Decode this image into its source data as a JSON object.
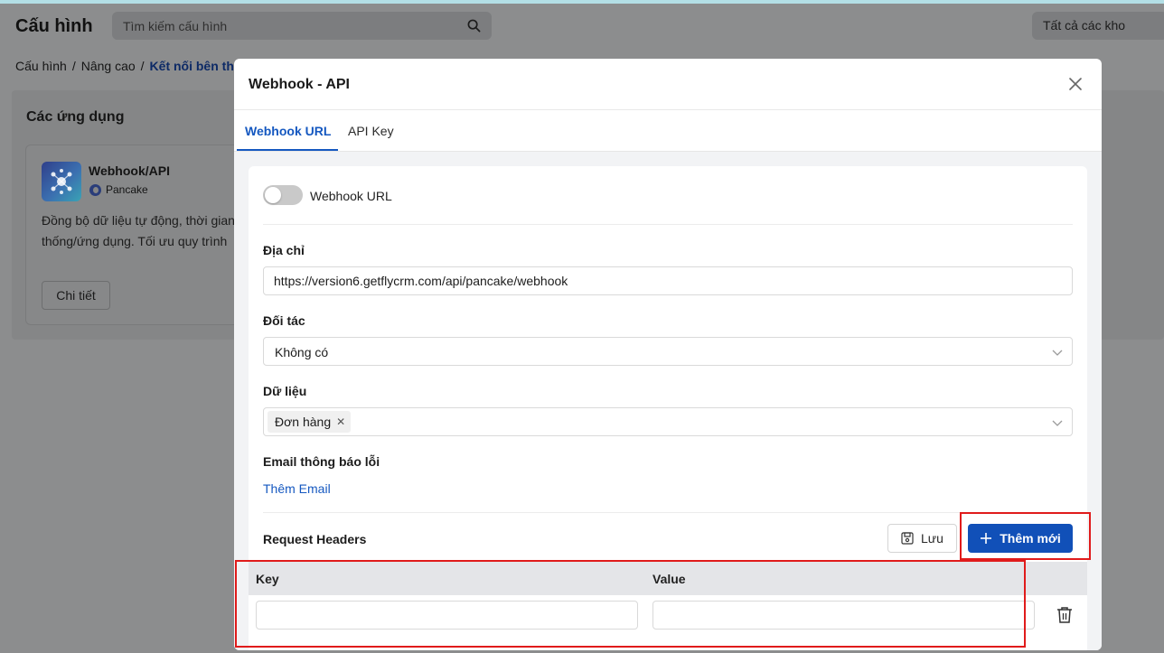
{
  "page": {
    "title": "Cấu hình",
    "search_placeholder": "Tìm kiếm cấu hình",
    "store_select": "Tất cả các kho",
    "breadcrumb": [
      "Cấu hình",
      "Nâng cao",
      "Kết nối bên th"
    ]
  },
  "apps": {
    "title": "Các ứng dụng",
    "card": {
      "name": "Webhook/API",
      "provider": "Pancake",
      "desc_line1": "Đồng bộ dữ liệu tự động, thời gian",
      "desc_line2": "thống/ứng dụng. Tối ưu quy trình",
      "detail_button": "Chi tiết"
    }
  },
  "modal": {
    "title": "Webhook - API",
    "tabs": [
      {
        "label": "Webhook URL",
        "active": true
      },
      {
        "label": "API Key",
        "active": false
      }
    ],
    "webhook_toggle": {
      "label": "Webhook URL",
      "enabled": false
    },
    "address": {
      "label": "Địa chỉ",
      "value": "https://version6.getflycrm.com/api/pancake/webhook"
    },
    "partner": {
      "label": "Đối tác",
      "value": "Không có"
    },
    "data_field": {
      "label": "Dữ liệu",
      "tags": [
        "Đơn hàng"
      ]
    },
    "error_email": {
      "label": "Email thông báo lỗi",
      "add_link": "Thêm Email"
    },
    "request_headers": {
      "title": "Request Headers",
      "save_button": "Lưu",
      "add_button": "Thêm mới",
      "columns": [
        "Key",
        "Value"
      ],
      "rows": [
        {
          "key": "",
          "value": ""
        }
      ]
    }
  },
  "colors": {
    "primary": "#1150b8",
    "link": "#1558c0",
    "highlight": "#e01b1b",
    "overlay": "#8c8d8e"
  }
}
